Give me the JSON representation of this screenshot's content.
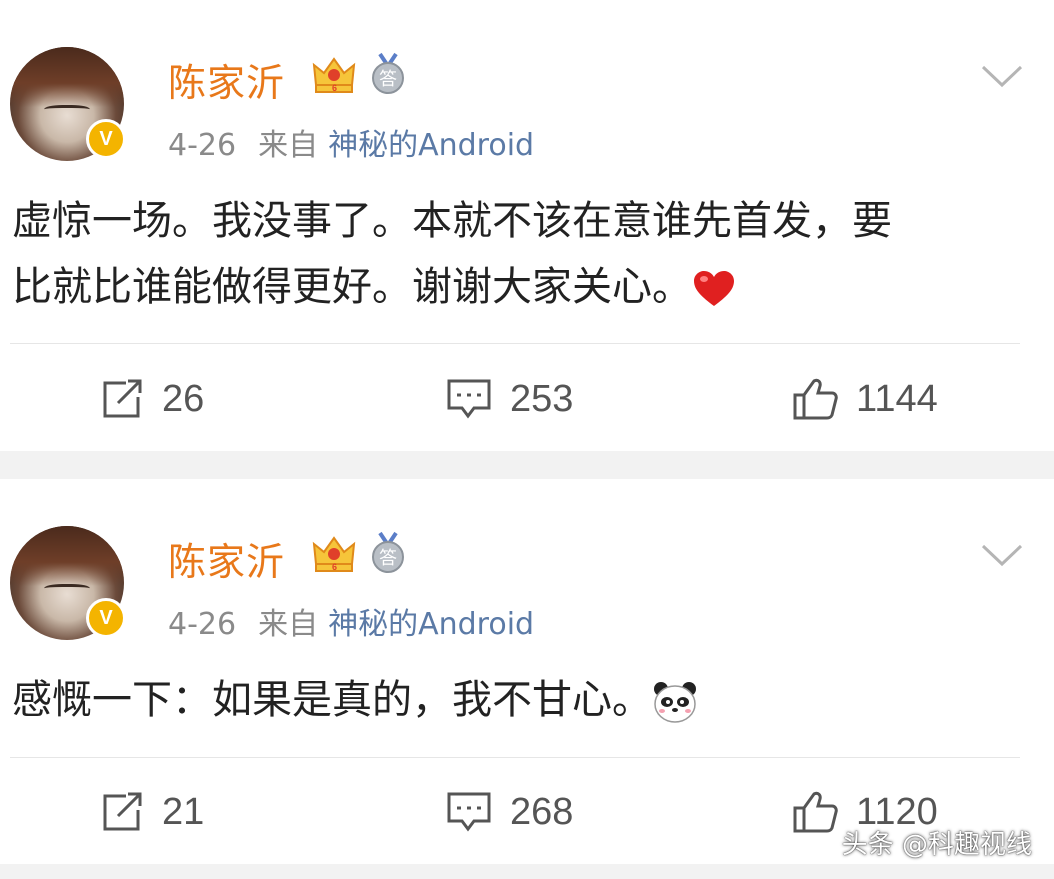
{
  "posts": [
    {
      "username": "陈家沂",
      "date": "4-26",
      "source_prefix": "来自",
      "source": "神秘的Android",
      "text_line1": "虚惊一场。我没事了。本就不该在意谁先首发，要",
      "text_line2": "比就比谁能做得更好。谢谢大家关心。",
      "emoji": "heart-emoji",
      "repost_count": "26",
      "comment_count": "253",
      "like_count": "1144"
    },
    {
      "username": "陈家沂",
      "date": "4-26",
      "source_prefix": "来自",
      "source": "神秘的Android",
      "text_line1": "感慨一下：如果是真的，我不甘心。",
      "emoji": "panda-emoji",
      "repost_count": "21",
      "comment_count": "268",
      "like_count": "1120"
    }
  ],
  "badges": {
    "verified": "V",
    "medal": "答"
  },
  "watermark": "头条 @科趣视线",
  "colors": {
    "username": "#e8781a",
    "source": "#5b7aa6",
    "meta": "#8a8a8a",
    "verified_badge": "#f4b400",
    "heart": "#e02020"
  }
}
